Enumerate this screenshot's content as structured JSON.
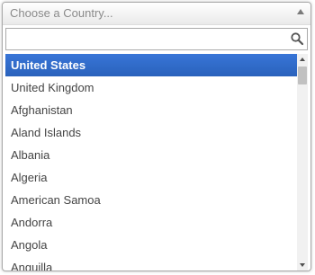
{
  "select": {
    "placeholder": "Choose a Country..."
  },
  "search": {
    "value": "",
    "placeholder": ""
  },
  "results": {
    "highlighted_index": 0,
    "items": [
      {
        "label": "United States"
      },
      {
        "label": "United Kingdom"
      },
      {
        "label": "Afghanistan"
      },
      {
        "label": "Aland Islands"
      },
      {
        "label": "Albania"
      },
      {
        "label": "Algeria"
      },
      {
        "label": "American Samoa"
      },
      {
        "label": "Andorra"
      },
      {
        "label": "Angola"
      },
      {
        "label": "Anguilla"
      }
    ]
  },
  "icons": {
    "dropdown_arrow": "chevron-up-icon",
    "search": "search-icon"
  },
  "colors": {
    "highlight": "#3875d7",
    "border": "#aaaaaa",
    "placeholder_text": "#8a8a8a",
    "item_text": "#444444"
  }
}
